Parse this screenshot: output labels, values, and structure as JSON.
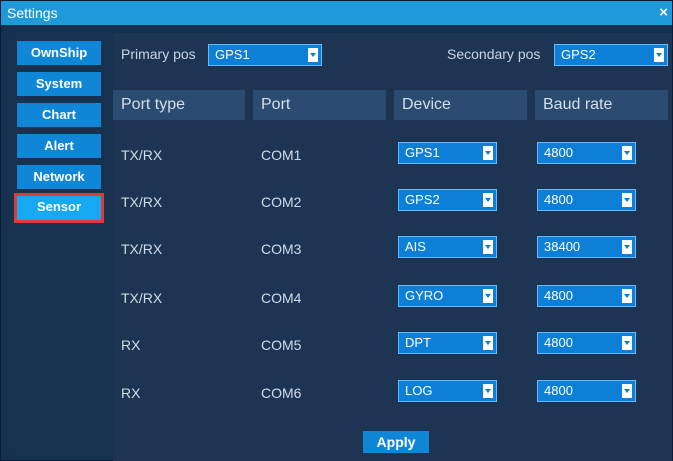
{
  "window": {
    "title": "Settings",
    "close_glyph": "×"
  },
  "sidebar": {
    "items": [
      {
        "label": "OwnShip"
      },
      {
        "label": "System"
      },
      {
        "label": "Chart"
      },
      {
        "label": "Alert"
      },
      {
        "label": "Network"
      },
      {
        "label": "Sensor",
        "active": true
      }
    ]
  },
  "primary_pos": {
    "label": "Primary pos",
    "value": "GPS1"
  },
  "secondary_pos": {
    "label": "Secondary pos",
    "value": "GPS2"
  },
  "table": {
    "headers": [
      "Port type",
      "Port",
      "Device",
      "Baud rate"
    ],
    "rows": [
      {
        "port_type": "TX/RX",
        "port": "COM1",
        "device": "GPS1",
        "baud": "4800"
      },
      {
        "port_type": "TX/RX",
        "port": "COM2",
        "device": "GPS2",
        "baud": "4800"
      },
      {
        "port_type": "TX/RX",
        "port": "COM3",
        "device": "AIS",
        "baud": "38400"
      },
      {
        "port_type": "TX/RX",
        "port": "COM4",
        "device": "GYRO",
        "baud": "4800"
      },
      {
        "port_type": "RX",
        "port": "COM5",
        "device": "DPT",
        "baud": "4800"
      },
      {
        "port_type": "RX",
        "port": "COM6",
        "device": "LOG",
        "baud": "4800"
      }
    ]
  },
  "apply_label": "Apply",
  "colors": {
    "accent": "#0f86d6",
    "active_tab": "#16a8f0",
    "highlight_border": "#e03a3a",
    "background": "#15304e"
  }
}
